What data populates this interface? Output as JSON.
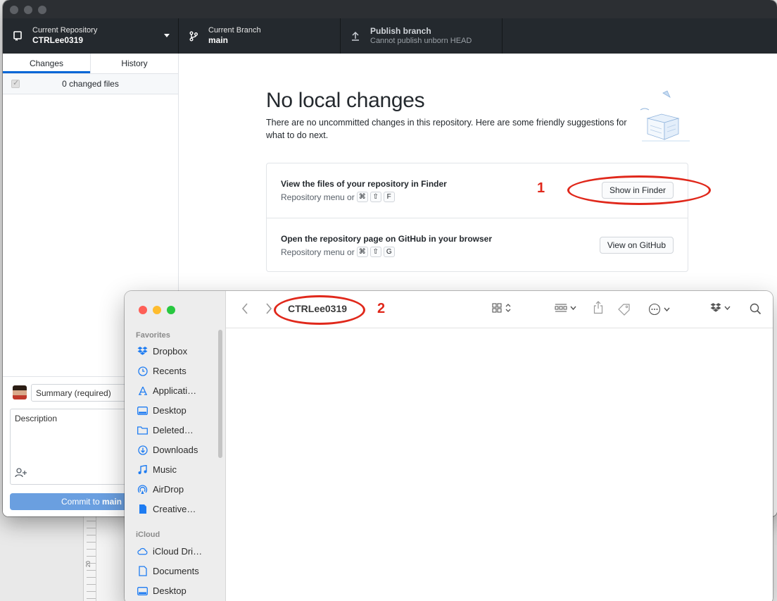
{
  "github": {
    "toolbar": {
      "repo_label": "Current Repository",
      "repo_name": "CTRLee0319",
      "branch_label": "Current Branch",
      "branch_name": "main",
      "publish_title": "Publish branch",
      "publish_sub": "Cannot publish unborn HEAD"
    },
    "tabs": [
      "Changes",
      "History"
    ],
    "changed_files": "0 changed files",
    "commit": {
      "summary_placeholder": "Summary (required)",
      "description_placeholder": "Description",
      "button_prefix": "Commit to ",
      "button_branch": "main"
    },
    "main": {
      "title": "No local changes",
      "subtitle": "There are no uncommitted changes in this repository. Here are some friendly suggestions for what to do next.",
      "suggestions": [
        {
          "title": "View the files of your repository in Finder",
          "hint": "Repository menu or",
          "keys": [
            "⌘",
            "⇧",
            "F"
          ],
          "button": "Show in Finder"
        },
        {
          "title": "Open the repository page on GitHub in your browser",
          "hint": "Repository menu or",
          "keys": [
            "⌘",
            "⇧",
            "G"
          ],
          "button": "View on GitHub"
        }
      ]
    }
  },
  "annotations": {
    "one": "1",
    "two": "2"
  },
  "finder": {
    "title": "CTRLee0319",
    "sections": {
      "favorites": "Favorites",
      "icloud": "iCloud"
    },
    "favorites": [
      {
        "label": "Dropbox",
        "icon": "dropbox-icon"
      },
      {
        "label": "Recents",
        "icon": "clock-icon"
      },
      {
        "label": "Applicati…",
        "icon": "applications-icon"
      },
      {
        "label": "Desktop",
        "icon": "desktop-icon"
      },
      {
        "label": "Deleted…",
        "icon": "folder-icon"
      },
      {
        "label": "Downloads",
        "icon": "download-icon"
      },
      {
        "label": "Music",
        "icon": "music-icon"
      },
      {
        "label": "AirDrop",
        "icon": "airdrop-icon"
      },
      {
        "label": "Creative…",
        "icon": "document-icon"
      }
    ],
    "icloud": [
      {
        "label": "iCloud Dri…",
        "icon": "cloud-icon"
      },
      {
        "label": "Documents",
        "icon": "document-icon"
      },
      {
        "label": "Desktop",
        "icon": "desktop-icon"
      }
    ]
  },
  "background": {
    "ruler_number": "20"
  },
  "colors": {
    "accent": "#0366d6",
    "annotation": "#e0281b",
    "toolbar": "#24292e",
    "finder_icon": "#1e7cf2"
  }
}
